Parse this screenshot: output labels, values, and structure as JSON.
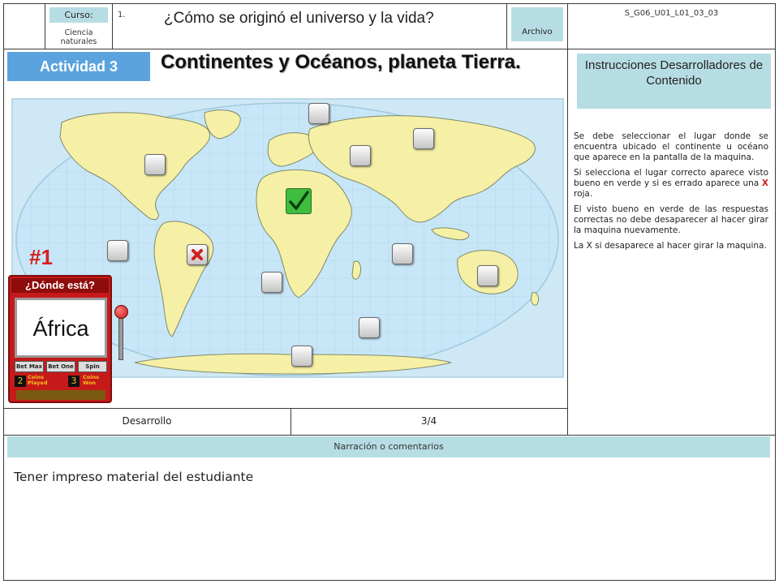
{
  "header": {
    "curso_label": "Curso:",
    "subject": "Ciencia naturales",
    "number": "1.",
    "question": "¿Cómo se originó el universo y la vida?",
    "archivo_label": "Archivo",
    "code": "S_G06_U01_L01_03_03"
  },
  "activity": {
    "tab_label": "Actividad 3",
    "title": "Continentes y Océanos, planeta Tierra.",
    "round": "#1",
    "machine_header": "¿Dónde está?",
    "machine_word": "África",
    "machine_buttons": [
      "Bet Max",
      "Bet One",
      "Spin"
    ],
    "coins_played_label": "Coins Played",
    "coins_won_label": "Coins Won",
    "coins_played": "2",
    "coins_won": "3"
  },
  "instructions": {
    "heading": "Instrucciones Desarrolladores de Contenido",
    "p1": "Se debe seleccionar el lugar donde se encuentra ubicado el continente u océano que aparece en la pantalla de la maquina.",
    "p2_a": "Si selecciona el lugar correcto aparece visto bueno en  verde y si es errado aparece una ",
    "p2_x": "X",
    "p2_b": " roja.",
    "p3": "El visto bueno en verde de las respuestas correctas no debe desaparecer al hacer girar la maquina nuevamente.",
    "p4": "La X si desaparece al hacer girar la maquina."
  },
  "footer": {
    "stage": "Desarrollo",
    "page": "3/4",
    "narration_label": "Narración o comentarios",
    "narration_text": "Tener impreso material del estudiante"
  },
  "colors": {
    "accent_blue": "#5aa3de",
    "header_cyan": "#b7dde4",
    "ocean": "#c7e6f7",
    "land": "#f6f0a6",
    "correct_green": "#1e9c22",
    "wrong_red": "#d21f1f",
    "machine_red": "#c61a1a"
  },
  "map_markers": [
    {
      "id": "north-atlantic",
      "state": "empty"
    },
    {
      "id": "arctic",
      "state": "empty"
    },
    {
      "id": "asia",
      "state": "empty"
    },
    {
      "id": "europe",
      "state": "empty"
    },
    {
      "id": "africa",
      "state": "correct"
    },
    {
      "id": "pacific-east",
      "state": "empty"
    },
    {
      "id": "south-america",
      "state": "wrong"
    },
    {
      "id": "indian-ocean",
      "state": "empty"
    },
    {
      "id": "oceania",
      "state": "empty"
    },
    {
      "id": "south-atlantic",
      "state": "empty"
    },
    {
      "id": "southern-ocean",
      "state": "empty"
    },
    {
      "id": "antarctica",
      "state": "empty"
    }
  ]
}
